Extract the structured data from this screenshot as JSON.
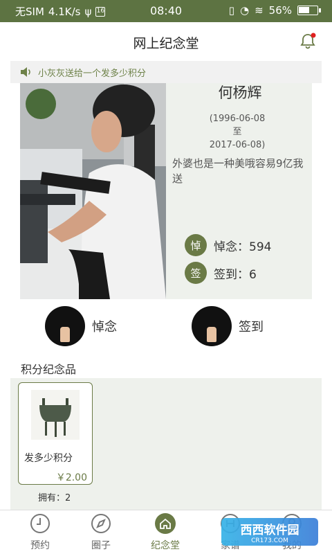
{
  "status_bar": {
    "carrier": "无SIM",
    "speed": "4.1K/s",
    "time": "08:40",
    "battery": "56%"
  },
  "header": {
    "title": "网上纪念堂"
  },
  "notice": {
    "text": "小灰灰送给一个发多少积分"
  },
  "profile": {
    "name": "何杨辉",
    "birth": "(1996-06-08",
    "separator": "至",
    "death": "2017-06-08)",
    "epitaph": "外婆也是一种美哦容易9亿我送",
    "mourn_badge": "悼",
    "mourn_label": "悼念：594",
    "checkin_badge": "签",
    "checkin_label": "签到：6"
  },
  "actions": {
    "mourn": "悼念",
    "checkin": "签到"
  },
  "gifts_section": {
    "title": "积分纪念品",
    "items": [
      {
        "name": "发多少积分",
        "price": "￥2.00",
        "owned": "拥有：2"
      }
    ]
  },
  "tabs": [
    {
      "label": "预约",
      "icon": "clock-icon"
    },
    {
      "label": "圈子",
      "icon": "compass-icon"
    },
    {
      "label": "纪念堂",
      "icon": "home-icon"
    },
    {
      "label": "家谱",
      "icon": "family-icon"
    },
    {
      "label": "我的",
      "icon": "user-icon"
    }
  ],
  "watermark": {
    "brand": "西西软件园",
    "url": "CR173.COM"
  },
  "colors": {
    "accent": "#5d7342",
    "panel": "#eef1ec"
  }
}
